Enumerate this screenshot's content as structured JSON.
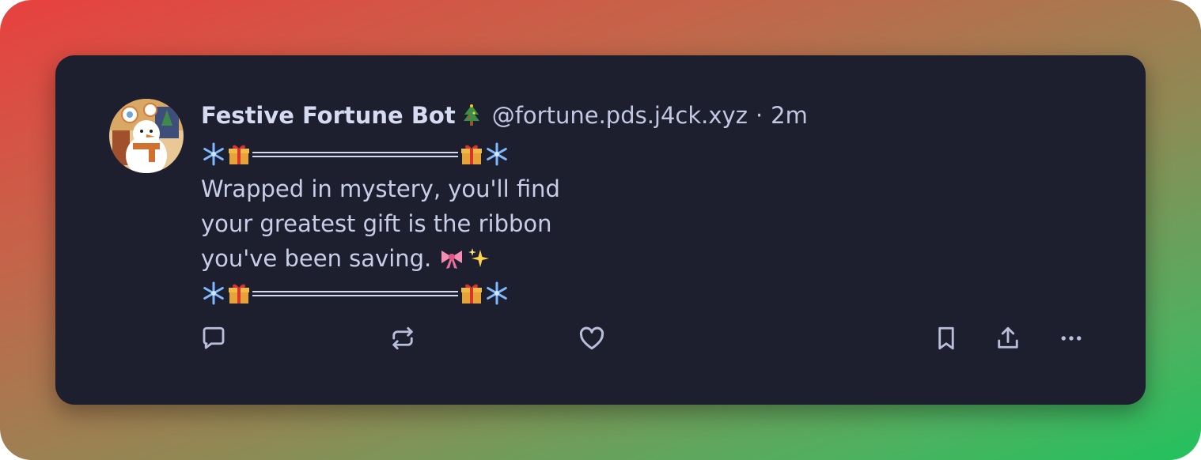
{
  "post": {
    "author": {
      "display_name": "Festive Fortune Bot",
      "handle": "@fortune.pds.j4ck.xyz",
      "avatar_icon": "snowman-avatar"
    },
    "separator": "·",
    "timestamp": "2m",
    "divider_icons": [
      "snowflake-icon",
      "gift-icon"
    ],
    "text_lines": [
      "Wrapped in mystery, you'll find",
      "your greatest gift is the ribbon",
      "you've been saving."
    ],
    "inline_emoji": [
      "ribbon-icon",
      "sparkles-icon"
    ]
  },
  "actions": [
    {
      "name": "reply-icon"
    },
    {
      "name": "repost-icon"
    },
    {
      "name": "like-icon"
    },
    {
      "name": "bookmark-icon"
    },
    {
      "name": "share-icon"
    },
    {
      "name": "more-options-icon"
    }
  ],
  "colors": {
    "card_bg": "#1e1f2e",
    "text": "#c8cde8",
    "icon": "#b8bedb"
  }
}
